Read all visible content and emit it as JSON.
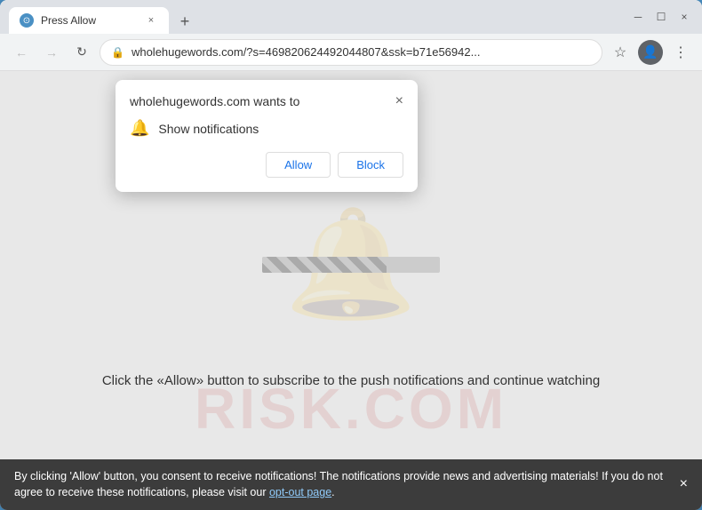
{
  "browser": {
    "tab": {
      "favicon": "⊙",
      "title": "Press Allow",
      "close_label": "×"
    },
    "new_tab_label": "+",
    "window_controls": {
      "minimize": "─",
      "maximize": "☐",
      "close": "×"
    },
    "nav": {
      "back": "←",
      "forward": "→",
      "reload": "↻"
    },
    "address": {
      "lock_icon": "🔒",
      "url": "wholehugewords.com/?s=469820624492044807&ssk=b71e56942...",
      "star": "☆",
      "profile": "👤",
      "menu": "⋮"
    }
  },
  "notification_popup": {
    "title": "wholehugewords.com wants to",
    "close_label": "×",
    "bell_icon": "🔔",
    "notification_text": "Show notifications",
    "allow_label": "Allow",
    "block_label": "Block"
  },
  "page": {
    "progress_percent": 70,
    "main_text": "Click the «Allow» button to subscribe to the push notifications and continue watching",
    "watermark_bell": "🔔",
    "risk_watermark": "RISK.COM"
  },
  "info_bar": {
    "text": "By clicking 'Allow' button, you consent to receive notifications! The notifications provide news and advertising materials! If you do not agree to receive these notifications, please visit our ",
    "link_text": "opt-out page",
    "close_label": "×"
  }
}
